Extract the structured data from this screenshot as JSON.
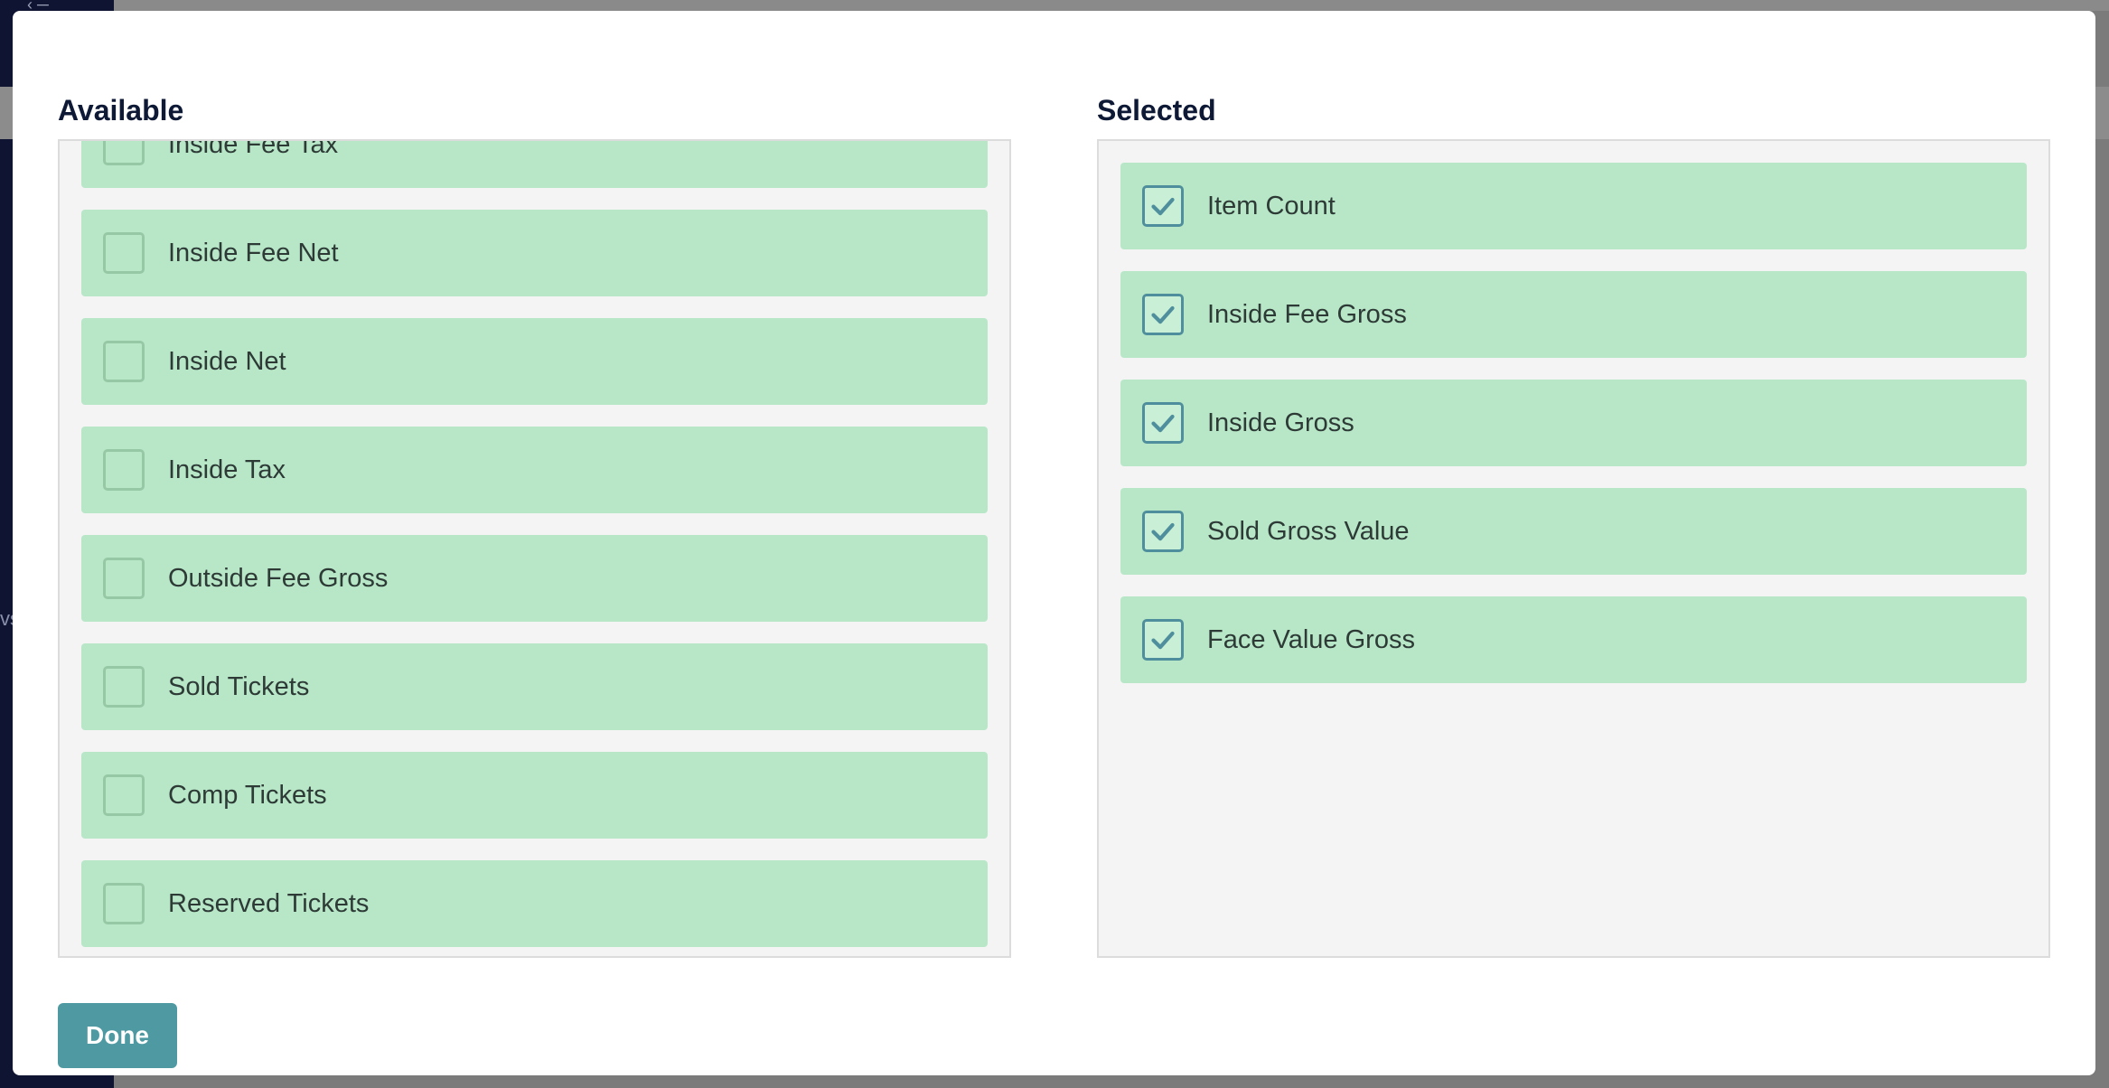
{
  "modal": {
    "available_title": "Available",
    "selected_title": "Selected",
    "done_label": "Done"
  },
  "available": [
    {
      "label": "Inside Fee Tax",
      "checked": false
    },
    {
      "label": "Inside Fee Net",
      "checked": false
    },
    {
      "label": "Inside Net",
      "checked": false
    },
    {
      "label": "Inside Tax",
      "checked": false
    },
    {
      "label": "Outside Fee Gross",
      "checked": false
    },
    {
      "label": "Sold Tickets",
      "checked": false
    },
    {
      "label": "Comp Tickets",
      "checked": false
    },
    {
      "label": "Reserved Tickets",
      "checked": false
    }
  ],
  "selected": [
    {
      "label": "Item Count",
      "checked": true
    },
    {
      "label": "Inside Fee Gross",
      "checked": true
    },
    {
      "label": "Inside Gross",
      "checked": true
    },
    {
      "label": "Sold Gross Value",
      "checked": true
    },
    {
      "label": "Face Value Gross",
      "checked": true
    }
  ],
  "icons": {
    "check": "check-icon",
    "background_menu": "menu-icon"
  },
  "background": {
    "side_text": "vs"
  },
  "colors": {
    "item_bg": "#b8e7c8",
    "checkbox_checked": "#4f8e9c",
    "button_bg": "#4f9aa2",
    "title": "#0e1936"
  }
}
